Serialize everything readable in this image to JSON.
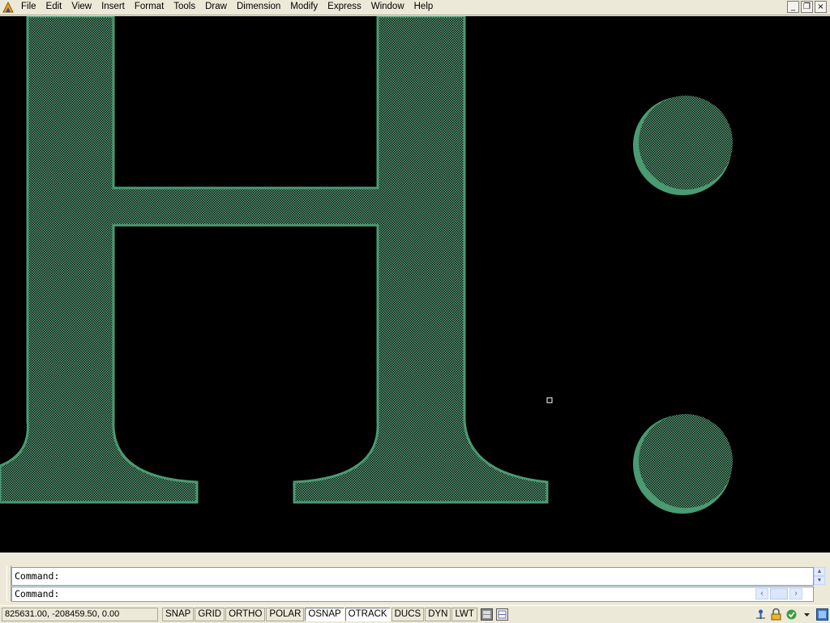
{
  "menubar": {
    "items": [
      "File",
      "Edit",
      "View",
      "Insert",
      "Format",
      "Tools",
      "Draw",
      "Dimension",
      "Modify",
      "Express",
      "Window",
      "Help"
    ],
    "window_controls": {
      "minimize": "_",
      "restore": "❐",
      "close": "×"
    }
  },
  "canvas": {
    "background": "#000000",
    "hatch_color": "#5a9c78",
    "outline_color": "#4a9a72",
    "visible_text": "H:"
  },
  "command": {
    "history": "Command:",
    "prompt": "Command:",
    "input_value": ""
  },
  "statusbar": {
    "coordinates": "825631.00, -208459.50, 0.00",
    "toggles": [
      {
        "label": "SNAP",
        "on": false
      },
      {
        "label": "GRID",
        "on": false
      },
      {
        "label": "ORTHO",
        "on": false
      },
      {
        "label": "POLAR",
        "on": false
      },
      {
        "label": "OSNAP",
        "on": true
      },
      {
        "label": "OTRACK",
        "on": true
      },
      {
        "label": "DUCS",
        "on": false
      },
      {
        "label": "DYN",
        "on": false
      },
      {
        "label": "LWT",
        "on": false
      }
    ],
    "icons": [
      "model-icon",
      "layout-icon"
    ],
    "tray_icons": [
      "communication-center-icon",
      "lock-icon",
      "status-tray-icon",
      "tray-menu-arrow-icon",
      "clean-screen-icon"
    ]
  }
}
